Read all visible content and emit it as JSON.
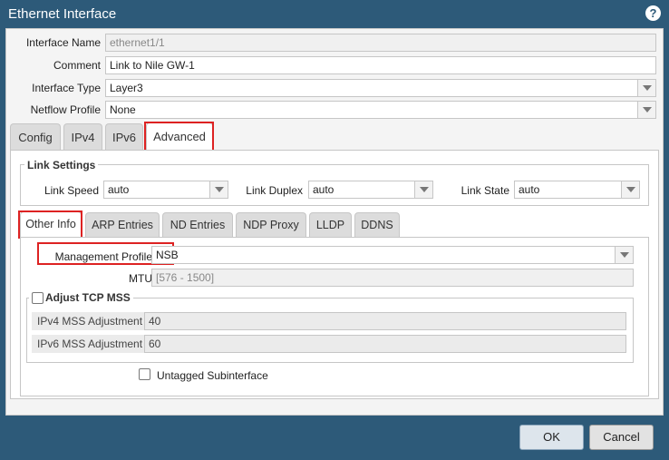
{
  "window": {
    "title": "Ethernet Interface"
  },
  "form": {
    "interface_name": {
      "label": "Interface Name",
      "value": "ethernet1/1"
    },
    "comment": {
      "label": "Comment",
      "value": "Link to Nile GW-1"
    },
    "interface_type": {
      "label": "Interface Type",
      "value": "Layer3"
    },
    "netflow_profile": {
      "label": "Netflow Profile",
      "value": "None"
    }
  },
  "tabs": [
    {
      "label": "Config"
    },
    {
      "label": "IPv4"
    },
    {
      "label": "IPv6"
    },
    {
      "label": "Advanced"
    }
  ],
  "link_settings": {
    "legend": "Link Settings",
    "link_speed": {
      "label": "Link Speed",
      "value": "auto"
    },
    "link_duplex": {
      "label": "Link Duplex",
      "value": "auto"
    },
    "link_state": {
      "label": "Link State",
      "value": "auto"
    }
  },
  "subtabs": [
    {
      "label": "Other Info"
    },
    {
      "label": "ARP Entries"
    },
    {
      "label": "ND Entries"
    },
    {
      "label": "NDP Proxy"
    },
    {
      "label": "LLDP"
    },
    {
      "label": "DDNS"
    }
  ],
  "other_info": {
    "management_profile": {
      "label": "Management Profile",
      "value": "NSB"
    },
    "mtu": {
      "label": "MTU",
      "placeholder": "[576 - 1500]"
    },
    "adjust_tcp_mss": {
      "label": "Adjust TCP MSS",
      "checked": false
    },
    "ipv4_mss": {
      "label": "IPv4 MSS Adjustment",
      "value": "40"
    },
    "ipv6_mss": {
      "label": "IPv6 MSS Adjustment",
      "value": "60"
    },
    "untagged_subinterface": {
      "label": "Untagged Subinterface",
      "checked": false
    }
  },
  "buttons": {
    "ok": "OK",
    "cancel": "Cancel"
  }
}
